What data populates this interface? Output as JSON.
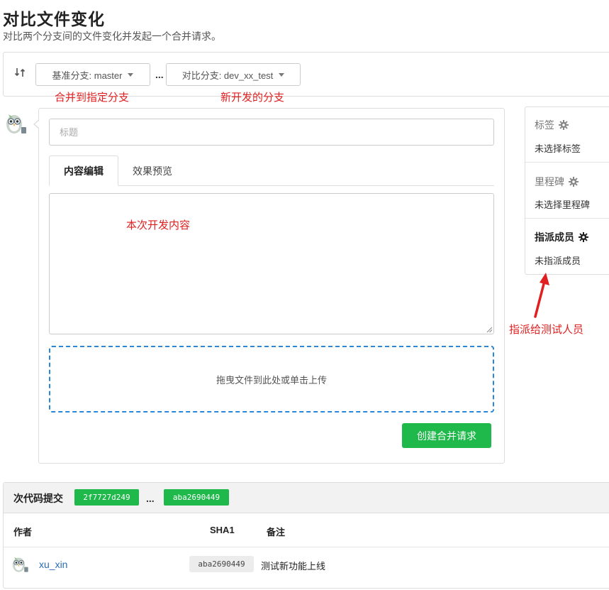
{
  "header": {
    "title": "对比文件变化",
    "subtitle": "对比两个分支间的文件变化并发起一个合并请求。"
  },
  "branches": {
    "base_label": "基准分支: master",
    "separator": "...",
    "compare_label": "对比分支: dev_xx_test"
  },
  "annotations": {
    "base_note": "合并到指定分支",
    "compare_note": "新开发的分支",
    "content_note": "本次开发内容",
    "assign_note": "指派给测试人员"
  },
  "editor": {
    "title_placeholder": "标题",
    "tabs": [
      {
        "label": "内容编辑",
        "active": true
      },
      {
        "label": "效果预览",
        "active": false
      }
    ],
    "dropzone_text": "拖曳文件到此处或单击上传",
    "submit_label": "创建合并请求"
  },
  "sidebar": {
    "labels": {
      "title": "标签",
      "value": "未选择标签"
    },
    "milestone": {
      "title": "里程碑",
      "value": "未选择里程碑"
    },
    "assignees": {
      "title": "指派成员",
      "value": "未指派成员"
    }
  },
  "commits": {
    "title": "次代码提交",
    "from_sha": "2f7727d249",
    "separator": "...",
    "to_sha": "aba2690449",
    "columns": {
      "author": "作者",
      "sha": "SHA1",
      "note": "备注"
    },
    "rows": [
      {
        "author": "xu_xin",
        "sha": "aba2690449",
        "note": "测试新功能上线"
      }
    ]
  },
  "colors": {
    "accent_green": "#1fb84a",
    "annotation_red": "#e02020",
    "link_blue": "#2a6db5",
    "dropzone_border": "#2a86d6"
  },
  "icons": [
    "swap-branches-icon",
    "caret-down-icon",
    "gear-icon",
    "avatar",
    "red-arrow"
  ]
}
